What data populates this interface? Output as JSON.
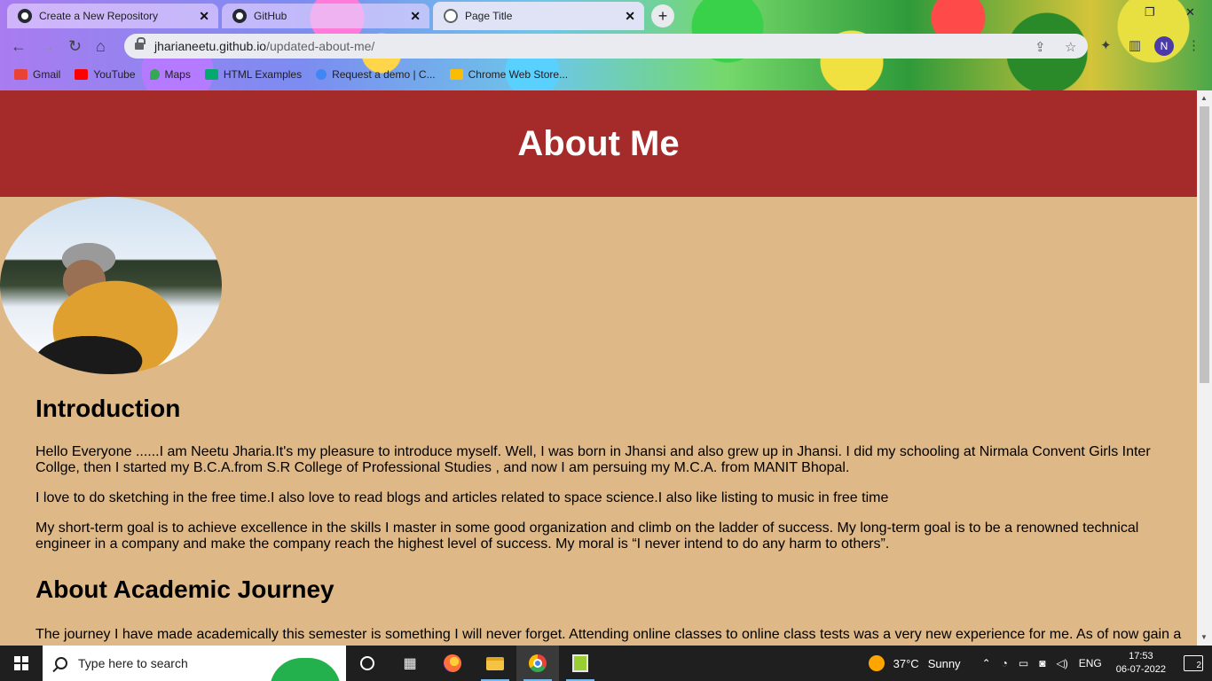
{
  "browser": {
    "tabs": [
      {
        "title": "Create a New Repository",
        "icon": "github-icon"
      },
      {
        "title": "GitHub",
        "icon": "github-icon"
      },
      {
        "title": "Page Title",
        "icon": "globe-icon"
      }
    ],
    "url_host": "jharianeetu.github.io",
    "url_path": "/updated-about-me/",
    "profile_initial": "N",
    "bookmarks": [
      {
        "label": "Gmail",
        "icon": "gmail-icon",
        "color": "#ea4335"
      },
      {
        "label": "YouTube",
        "icon": "youtube-icon",
        "color": "#ff0000"
      },
      {
        "label": "Maps",
        "icon": "maps-icon",
        "color": "#34a853"
      },
      {
        "label": "HTML Examples",
        "icon": "w3-icon",
        "color": "#04aa6d"
      },
      {
        "label": "Request a demo | C...",
        "icon": "demo-icon",
        "color": "#4285f4"
      },
      {
        "label": "Chrome Web Store...",
        "icon": "webstore-icon",
        "color": "#fbbc05"
      }
    ]
  },
  "page": {
    "header_title": "About Me",
    "header_color": "#a52a2a",
    "background_color": "#deb887",
    "intro_heading": "Introduction",
    "intro_paragraphs": [
      "Hello Everyone ......I am Neetu Jharia.It's my pleasure to introduce myself. Well, I was born in Jhansi and also grew up in Jhansi. I did my schooling at Nirmala Convent Girls Inter Collge, then I started my B.C.A.from S.R College of Professional Studies , and now I am persuing my M.C.A. from MANIT Bhopal.",
      "I love to do sketching in the free time.I also love to read blogs and articles related to space science.I also like listing to music in free time",
      "My short-term goal is to achieve excellence in the skills I master in some good organization and climb on the ladder of success. My long-term goal is to be a renowned technical engineer in a company and make the company reach the highest level of success. My moral is “I never intend to do any harm to others”."
    ],
    "academic_heading": "About Academic Journey",
    "academic_paragraph": "The journey I have made academically this semester is something I will never forget. Attending online classes to online class tests was a very new experience for me. As of now gain a"
  },
  "taskbar": {
    "search_placeholder": "Type here to search",
    "weather_temp": "37°C",
    "weather_text": "Sunny",
    "language": "ENG",
    "time": "17:53",
    "date": "06-07-2022",
    "notification_count": "2"
  }
}
